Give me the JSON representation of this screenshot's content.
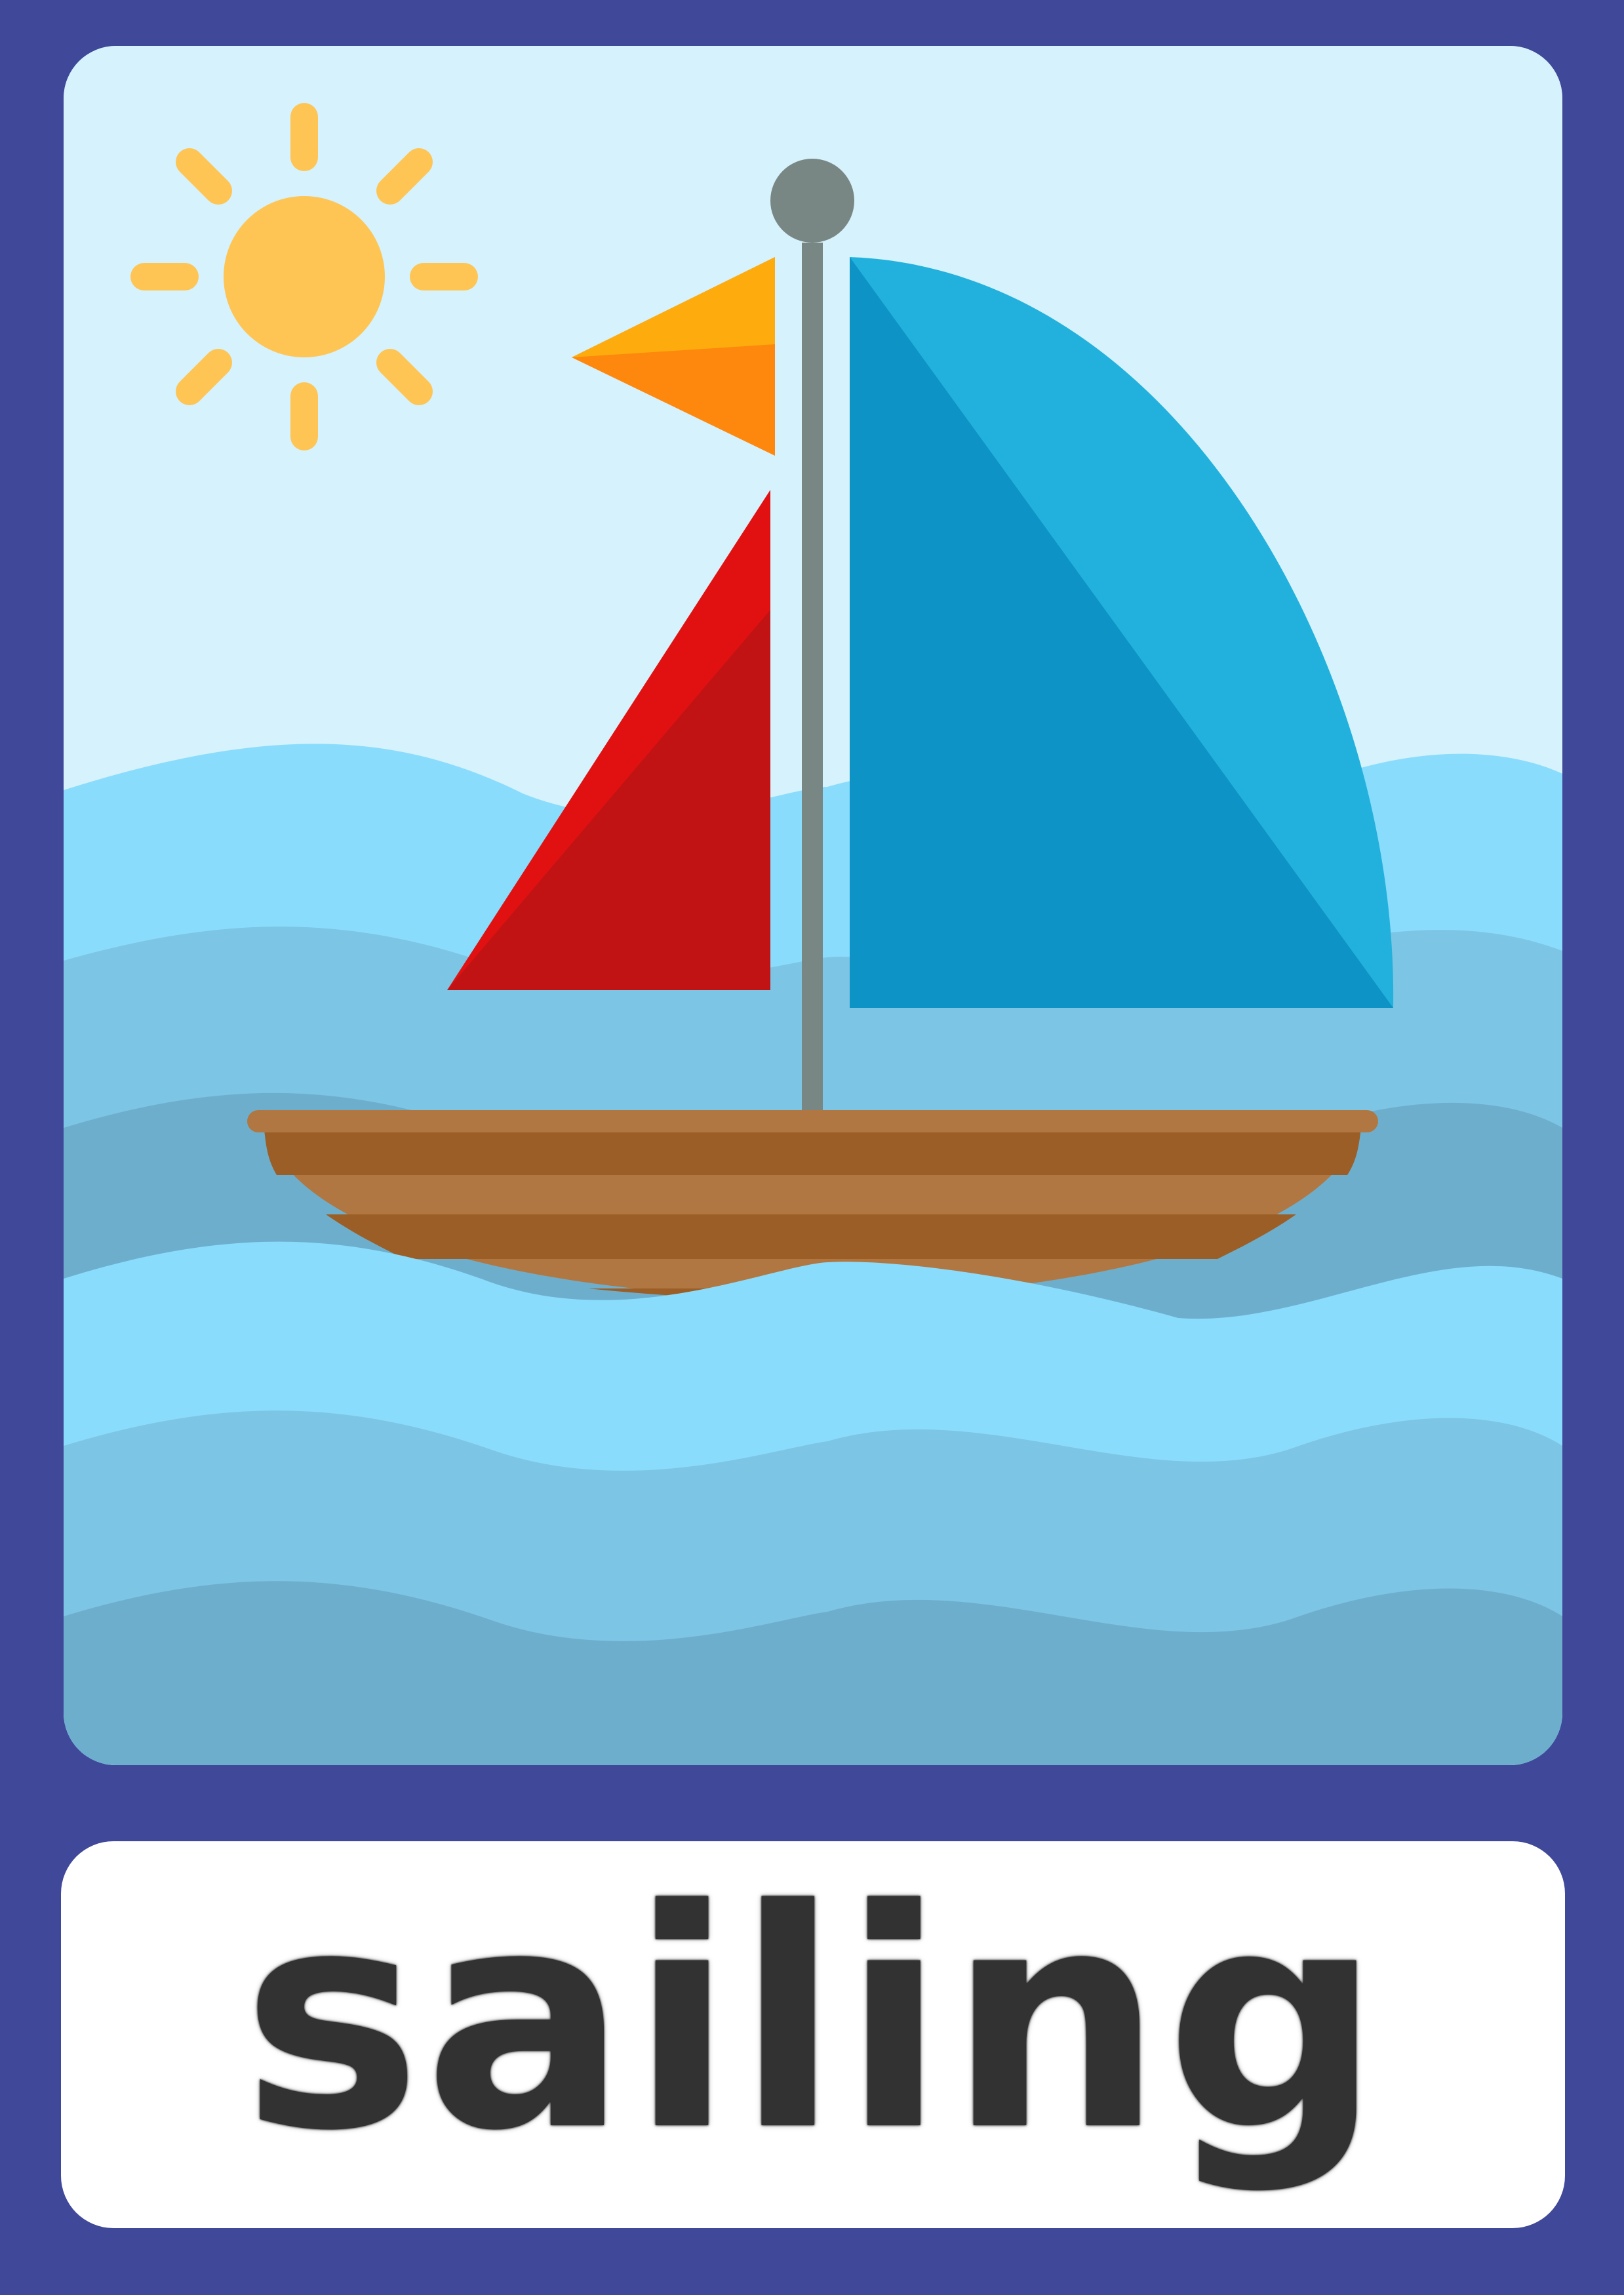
{
  "card": {
    "word": "sailing"
  },
  "colors": {
    "frame": "#404899",
    "sky": "#d6f2fc",
    "sun": "#fec555",
    "water_light": "#8adcfd",
    "water_mid": "#7dc5e4",
    "water_dark": "#6eaecd",
    "hull_light": "#b07742",
    "hull_dark": "#9b5e26",
    "mast": "#798784",
    "flag_top": "#feac0d",
    "flag_bottom": "#fe870d",
    "jib_light": "#e11111",
    "jib_dark": "#c11313",
    "mainsail_light": "#22b1dd",
    "mainsail_dark": "#0d93c6",
    "label_bg": "#ffffff",
    "text": "#323232"
  },
  "icons": [
    "sun-icon",
    "sailboat-icon",
    "flag-icon",
    "waves"
  ]
}
